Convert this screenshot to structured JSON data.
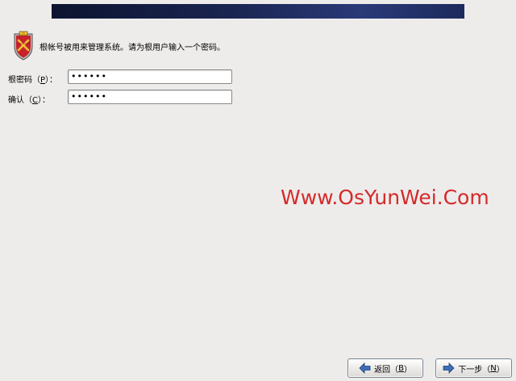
{
  "header": {
    "banner_color": "#1a2552"
  },
  "prompt": {
    "icon": "shield-crest-icon",
    "text": "根帐号被用来管理系统。请为根用户输入一个密码。"
  },
  "password": {
    "label_prefix": "根密码（",
    "label_key": "P",
    "label_suffix": "）：",
    "value": "••••••"
  },
  "confirm": {
    "label_prefix": "确认（",
    "label_key": "C",
    "label_suffix": "）：",
    "value": "••••••"
  },
  "watermark": {
    "text": "Www.OsYunWei.Com",
    "color": "#d42a2a"
  },
  "footer": {
    "back": {
      "icon": "arrow-left-icon",
      "label_prefix": "返回（",
      "label_key": "B",
      "label_suffix": "）"
    },
    "next": {
      "icon": "arrow-right-icon",
      "label_prefix": "下一步（",
      "label_key": "N",
      "label_suffix": "）"
    }
  }
}
